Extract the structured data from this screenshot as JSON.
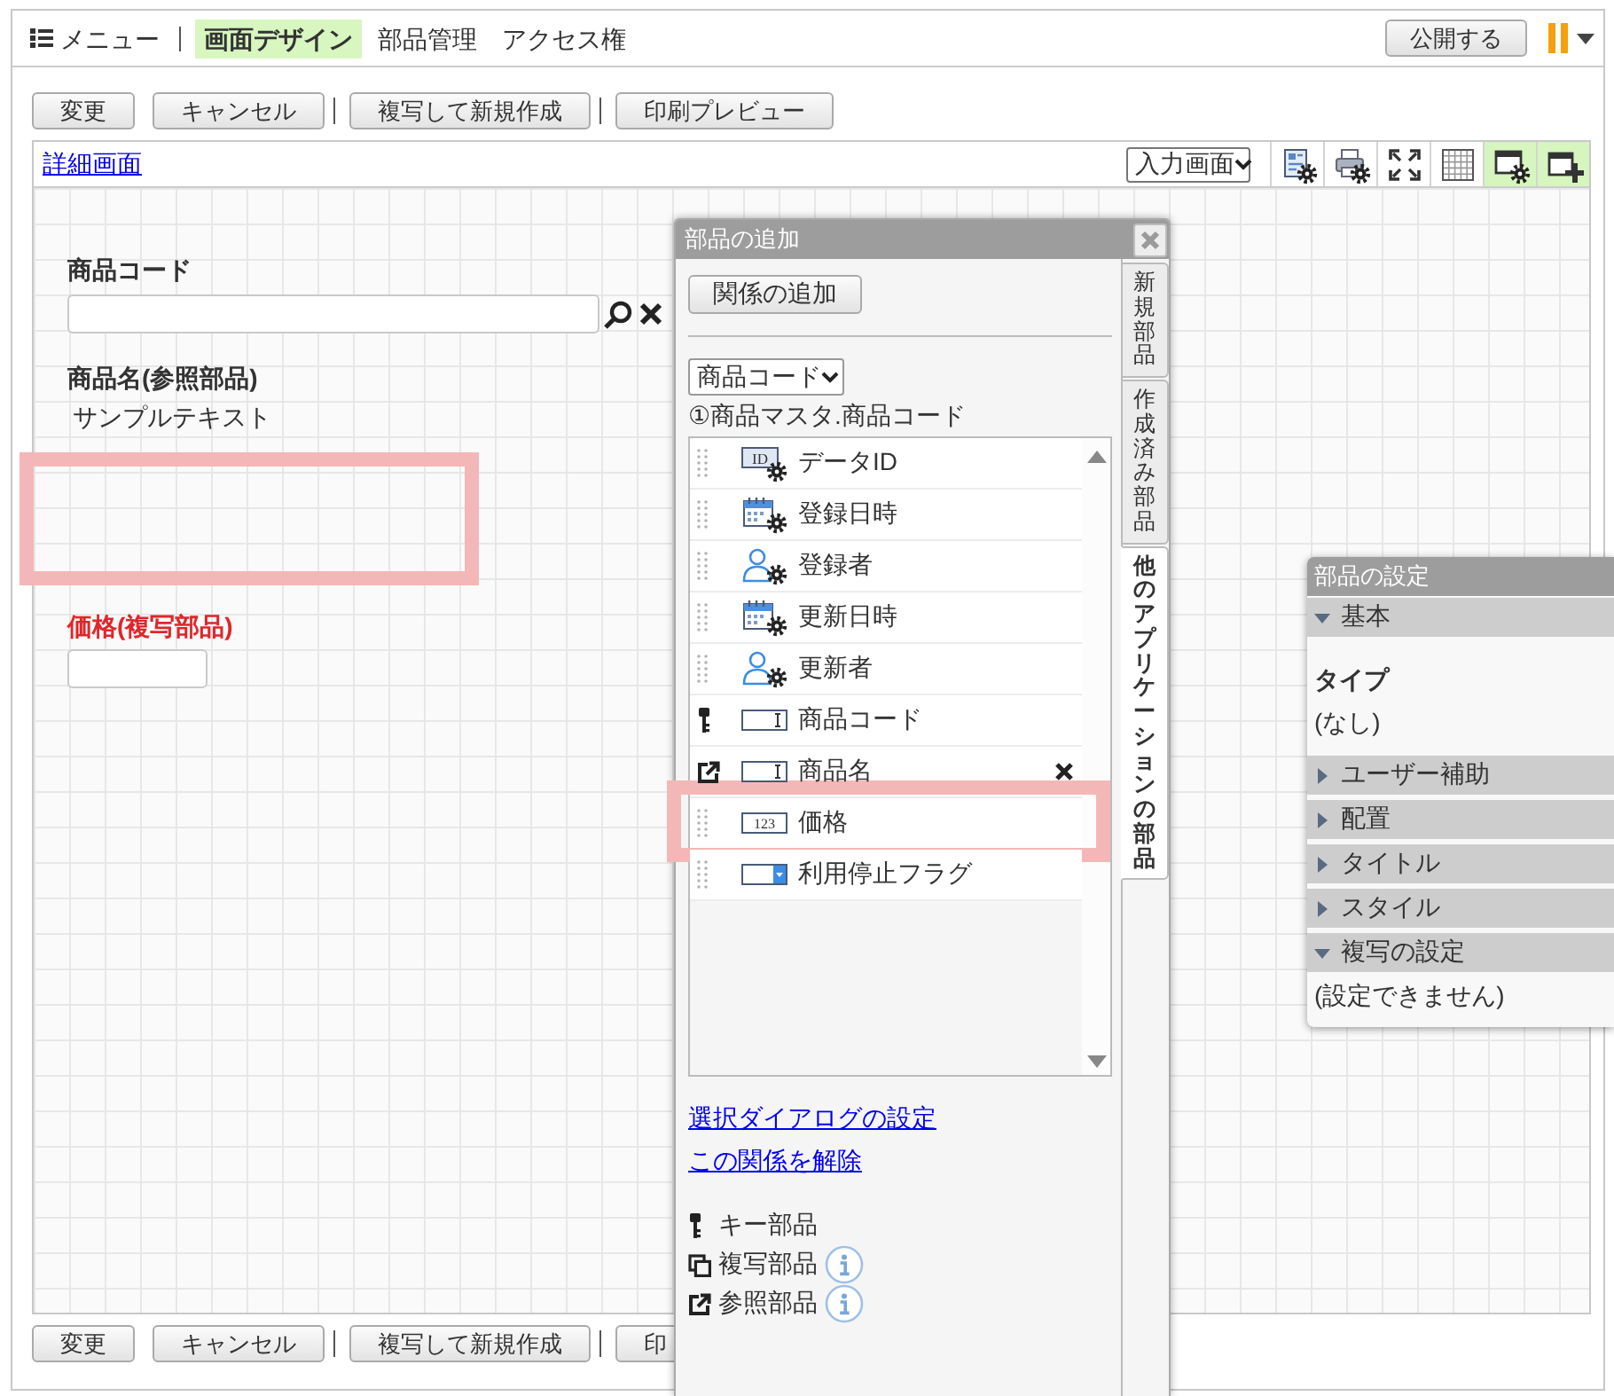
{
  "top_bar": {
    "menu_label": "メニュー",
    "nav": [
      {
        "label": "画面デザイン",
        "selected": true
      },
      {
        "label": "部品管理",
        "selected": false
      },
      {
        "label": "アクセス権",
        "selected": false
      }
    ],
    "publish_button": "公開する"
  },
  "toolbar_top": {
    "groups": [
      [
        "変更",
        "キャンセル"
      ],
      [
        "複写して新規作成"
      ],
      [
        "印刷プレビュー"
      ]
    ]
  },
  "design_panel": {
    "link": "詳細画面",
    "screen_select": "入力画面",
    "tools": [
      {
        "kind": "form_settings",
        "on": false
      },
      {
        "kind": "print_settings",
        "on": false
      },
      {
        "kind": "fullscreen",
        "on": false
      },
      {
        "kind": "grid",
        "on": false
      },
      {
        "kind": "dialog_settings",
        "on": true
      },
      {
        "kind": "add_part",
        "on": true
      }
    ],
    "fields": [
      {
        "kind": "lookup",
        "label": "商品コード",
        "selected": false
      },
      {
        "kind": "display",
        "label": "商品名(参照部品)",
        "value": "サンプルテキスト",
        "selected": false
      },
      {
        "kind": "drop_target"
      },
      {
        "kind": "input",
        "label": "価格(複写部品)",
        "selected": true
      }
    ]
  },
  "toolbar_bottom": {
    "groups": [
      [
        "変更",
        "キャンセル"
      ],
      [
        "複写して新規作成"
      ],
      [
        "印"
      ]
    ]
  },
  "add_parts_dialog": {
    "title": "部品の追加",
    "add_relation_button": "関係の追加",
    "relation_select": "商品コード",
    "relation_path": "①商品マスタ.商品コード",
    "parts": [
      {
        "kind": "id",
        "label": "データID",
        "icon_text": "ID",
        "key_part": false,
        "reference_part": false,
        "removable": false,
        "highlighted": false
      },
      {
        "kind": "datetime",
        "label": "登録日時",
        "key_part": false,
        "reference_part": false,
        "removable": false,
        "highlighted": false
      },
      {
        "kind": "user",
        "label": "登録者",
        "key_part": false,
        "reference_part": false,
        "removable": false,
        "highlighted": false
      },
      {
        "kind": "datetime",
        "label": "更新日時",
        "key_part": false,
        "reference_part": false,
        "removable": false,
        "highlighted": false
      },
      {
        "kind": "user",
        "label": "更新者",
        "key_part": false,
        "reference_part": false,
        "removable": false,
        "highlighted": false
      },
      {
        "kind": "text",
        "label": "商品コード",
        "key_part": true,
        "reference_part": false,
        "removable": false,
        "highlighted": false
      },
      {
        "kind": "text",
        "label": "商品名",
        "key_part": false,
        "reference_part": true,
        "removable": true,
        "highlighted": false
      },
      {
        "kind": "number",
        "label": "価格",
        "icon_text": "123",
        "key_part": false,
        "reference_part": false,
        "removable": false,
        "highlighted": true
      },
      {
        "kind": "dropdown",
        "label": "利用停止フラグ",
        "key_part": false,
        "reference_part": false,
        "removable": false,
        "highlighted": false
      }
    ],
    "links": [
      "選択ダイアログの設定",
      "この関係を解除"
    ],
    "legend": [
      {
        "kind": "key",
        "label": "キー部品",
        "info": false
      },
      {
        "kind": "copy",
        "label": "複写部品",
        "info": true
      },
      {
        "kind": "reference",
        "label": "参照部品",
        "info": true
      }
    ],
    "tabs": [
      {
        "label": "新規部品",
        "selected": false
      },
      {
        "label": "作成済み部品",
        "selected": false
      },
      {
        "label": "他のアプリケーションの部品",
        "selected": true
      }
    ]
  },
  "parts_settings": {
    "title": "部品の設定",
    "sections": [
      {
        "title": "基本",
        "expanded": true,
        "items": [
          {
            "kind": "label",
            "text": "タイプ"
          },
          {
            "kind": "value",
            "text": "(なし)"
          }
        ]
      },
      {
        "title": "ユーザー補助",
        "expanded": false
      },
      {
        "title": "配置",
        "expanded": false
      },
      {
        "title": "タイトル",
        "expanded": false
      },
      {
        "title": "スタイル",
        "expanded": false
      },
      {
        "title": "複写の設定",
        "expanded": true,
        "items": [
          {
            "kind": "value",
            "text": "(設定できません)"
          }
        ]
      }
    ]
  }
}
